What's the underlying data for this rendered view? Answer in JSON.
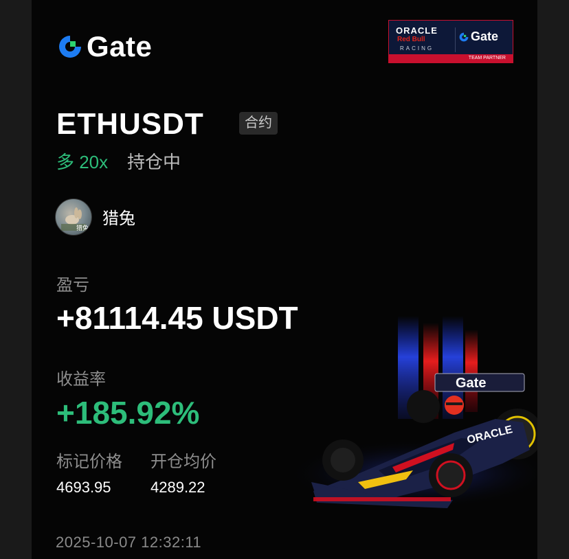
{
  "brand": {
    "name": "Gate",
    "color": "#1d7cf2"
  },
  "partner": {
    "oracle": "ORACLE",
    "redbull": "Red Bull",
    "racing": "RACING",
    "gate": "Gate",
    "team_partner": "TEAM PARTNER"
  },
  "position": {
    "symbol": "ETHUSDT",
    "type_tag": "合约",
    "side_leverage": "多 20x",
    "status": "持仓中"
  },
  "user": {
    "name": "猎兔",
    "avatar_label": "猎兔"
  },
  "pnl": {
    "label": "盈亏",
    "value": "+81114.45 USDT"
  },
  "roi": {
    "label": "收益率",
    "value": "+185.92%"
  },
  "prices": {
    "mark_label": "标记价格",
    "mark_value": "4693.95",
    "entry_label": "开仓均价",
    "entry_value": "4289.22"
  },
  "timestamp": "2025-10-07 12:32:11",
  "car": {
    "livery_text": "Gate",
    "sponsor": "ORACLE"
  },
  "colors": {
    "profit": "#2dbd7a",
    "background": "#050505",
    "accent_red": "#c8102e"
  }
}
